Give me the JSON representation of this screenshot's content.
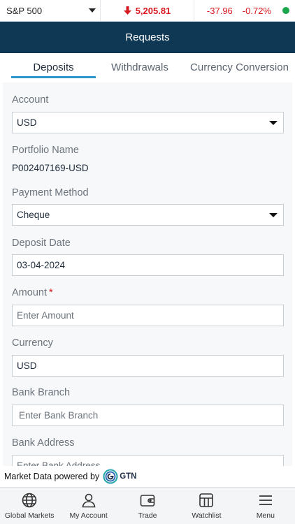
{
  "ticker": {
    "index_name": "S&P 500",
    "price": "5,205.81",
    "change": "-37.96",
    "change_pct": "-0.72%",
    "colors": {
      "down": "#d71920",
      "status": "#1aa64b"
    }
  },
  "header": {
    "title": "Requests"
  },
  "tabs": [
    {
      "label": "Deposits",
      "active": true
    },
    {
      "label": "Withdrawals",
      "active": false
    },
    {
      "label": "Currency Conversion",
      "active": false
    }
  ],
  "form": {
    "account": {
      "label": "Account",
      "value": "USD"
    },
    "portfolio": {
      "label": "Portfolio Name",
      "value": "P002407169-USD"
    },
    "payment_method": {
      "label": "Payment Method",
      "value": "Cheque"
    },
    "deposit_date": {
      "label": "Deposit Date",
      "value": "03-04-2024"
    },
    "amount": {
      "label": "Amount",
      "required_mark": "*",
      "placeholder": "Enter Amount"
    },
    "currency": {
      "label": "Currency",
      "value": "USD"
    },
    "bank_branch": {
      "label": "Bank Branch",
      "placeholder": "Enter Bank Branch"
    },
    "bank_address": {
      "label": "Bank Address",
      "placeholder": "Enter Bank Address"
    }
  },
  "powered_by": {
    "text": "Market Data powered by",
    "logo_text": "GTN"
  },
  "bottom_nav": [
    {
      "label": "Global Markets",
      "icon": "globe-icon"
    },
    {
      "label": "My Account",
      "icon": "user-icon"
    },
    {
      "label": "Trade",
      "icon": "wallet-icon"
    },
    {
      "label": "Watchlist",
      "icon": "grid-icon"
    },
    {
      "label": "Menu",
      "icon": "menu-icon"
    }
  ],
  "theme": {
    "header_bg": "#0f3855",
    "tab_indicator": "#2a96c9"
  }
}
